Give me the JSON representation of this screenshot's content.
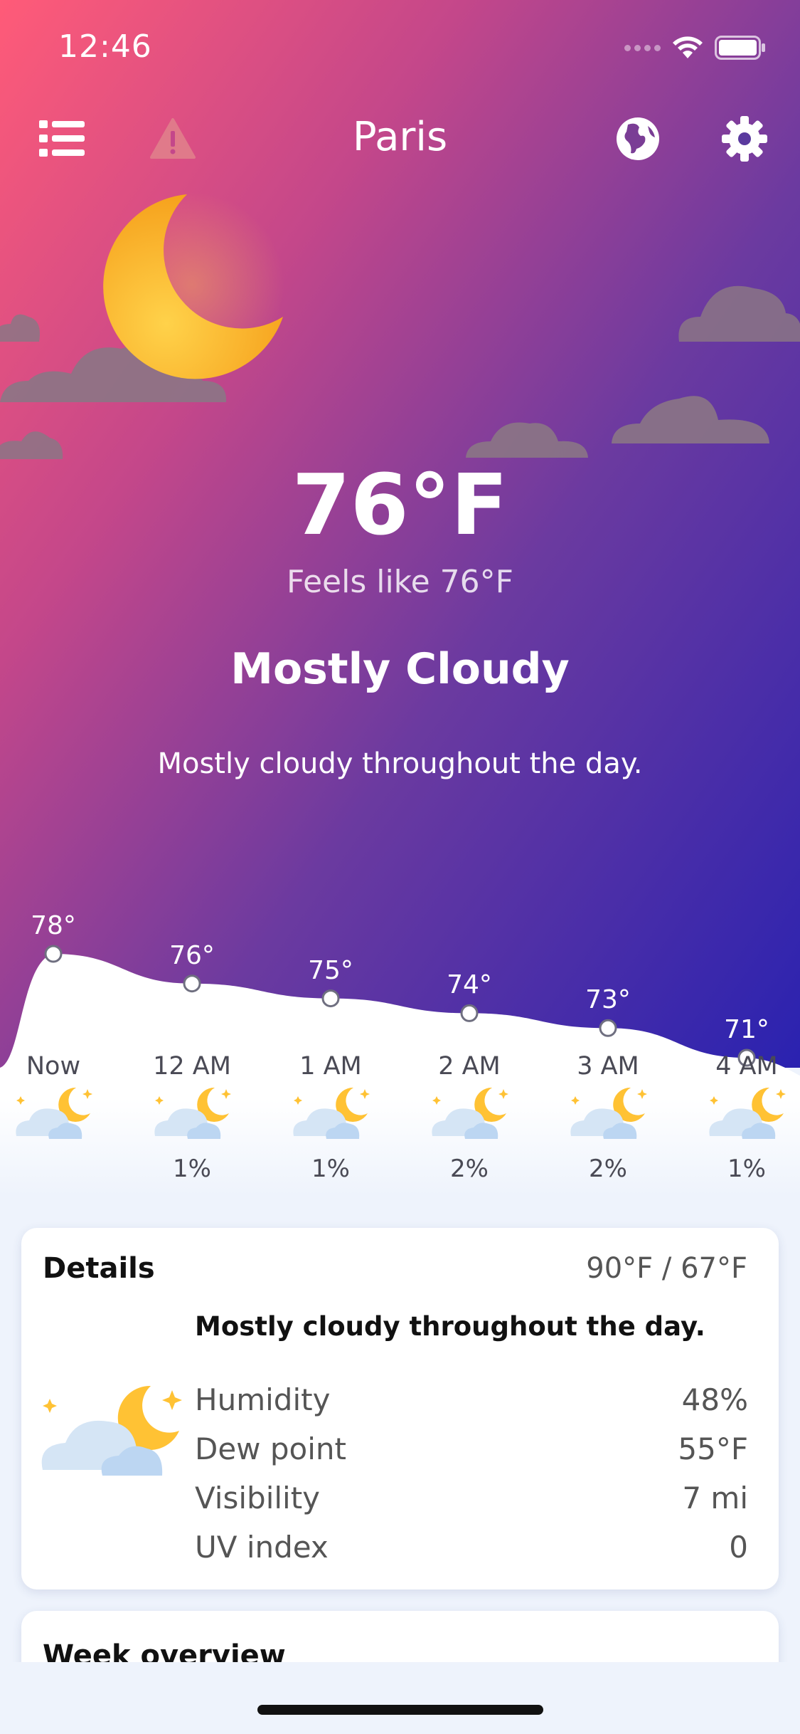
{
  "status_bar": {
    "time": "12:46"
  },
  "header": {
    "city": "Paris",
    "menu_icon": "list-icon",
    "alert_icon": "warning-icon",
    "globe_icon": "globe-icon",
    "settings_icon": "gear-icon"
  },
  "current": {
    "temperature": "76°F",
    "feels_like": "Feels like 76°F",
    "condition": "Mostly Cloudy",
    "summary": "Mostly cloudy throughout the day."
  },
  "hourly": [
    {
      "time": "Now",
      "temp": "78°",
      "temp_value": 78,
      "pop": "",
      "icon": "partly-cloudy-night-icon"
    },
    {
      "time": "12 AM",
      "temp": "76°",
      "temp_value": 76,
      "pop": "1%",
      "icon": "partly-cloudy-night-icon"
    },
    {
      "time": "1 AM",
      "temp": "75°",
      "temp_value": 75,
      "pop": "1%",
      "icon": "partly-cloudy-night-icon"
    },
    {
      "time": "2 AM",
      "temp": "74°",
      "temp_value": 74,
      "pop": "2%",
      "icon": "partly-cloudy-night-icon"
    },
    {
      "time": "3 AM",
      "temp": "73°",
      "temp_value": 73,
      "pop": "2%",
      "icon": "partly-cloudy-night-icon"
    },
    {
      "time": "4 AM",
      "temp": "71°",
      "temp_value": 71,
      "pop": "1%",
      "icon": "partly-cloudy-night-icon"
    }
  ],
  "details": {
    "title": "Details",
    "range": "90°F / 67°F",
    "summary": "Mostly cloudy throughout the day.",
    "rows": [
      {
        "label": "Humidity",
        "value": "48%"
      },
      {
        "label": "Dew point",
        "value": "55°F"
      },
      {
        "label": "Visibility",
        "value": "7 mi"
      },
      {
        "label": "UV index",
        "value": "0"
      }
    ]
  },
  "week": {
    "title": "Week overview"
  },
  "colors": {
    "gradient_start": "#ff5b78",
    "gradient_mid": "#6b3aa0",
    "gradient_end": "#2a22b0",
    "moon": "#ffc234",
    "card_bg": "#ffffff",
    "page_bg": "#eef3fc"
  }
}
